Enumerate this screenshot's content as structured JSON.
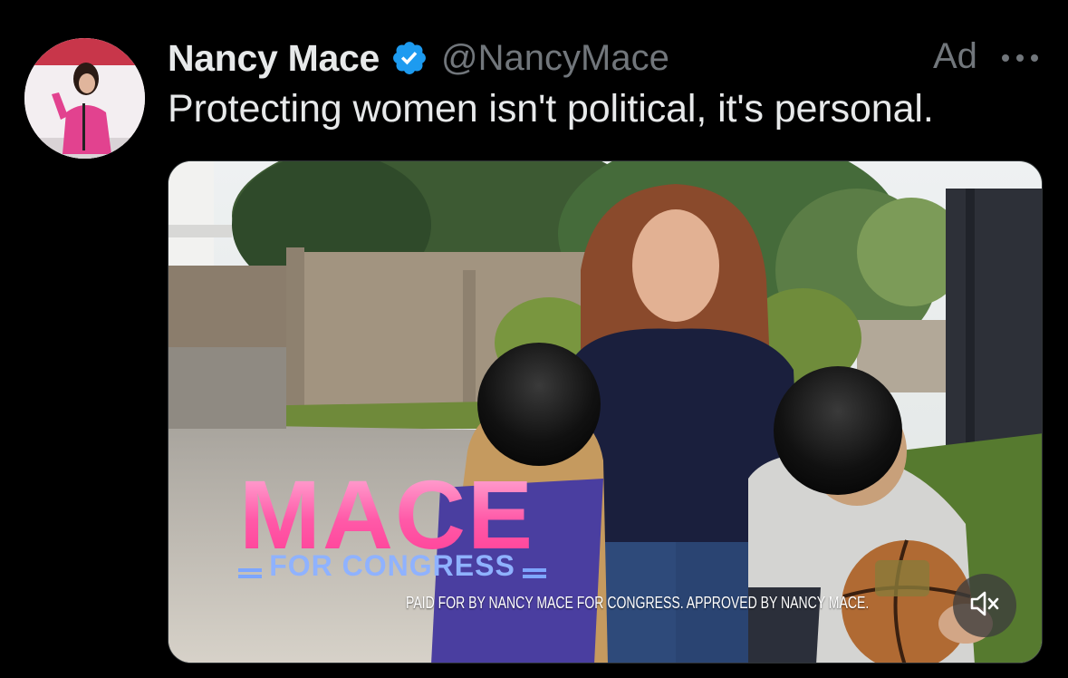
{
  "post": {
    "author": {
      "display_name": "Nancy Mace",
      "handle": "@NancyMace",
      "verified": true,
      "verified_icon": "verified-badge-icon",
      "verified_color": "#1d9bf0"
    },
    "ad_label": "Ad",
    "more_icon": "more-horizontal-icon",
    "text": "Protecting women isn't political, it's personal."
  },
  "media": {
    "logo_main": "MACE",
    "logo_sub": "FOR CONGRESS",
    "disclaimer": "PAID FOR BY NANCY MACE FOR CONGRESS. APPROVED BY NANCY MACE.",
    "mute_icon": "volume-muted-icon",
    "colors": {
      "logo_pink": "#ff4fa3",
      "logo_blue": "#8fb2ff"
    }
  },
  "theme": {
    "background": "#000000",
    "text": "#e7e9ea",
    "secondary_text": "#71767b"
  }
}
